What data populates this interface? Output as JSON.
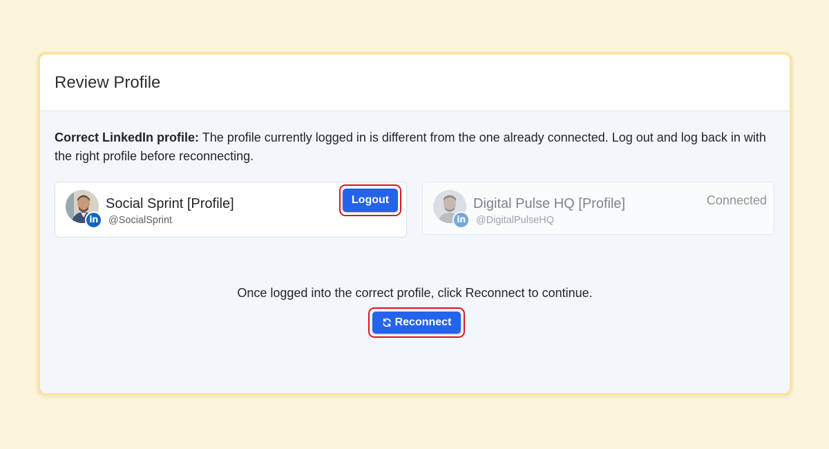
{
  "modal": {
    "title": "Review Profile"
  },
  "message": {
    "bold": "Correct LinkedIn profile:",
    "text": " The profile currently logged in is different from the one already connected. Log out and log back in with the right profile before reconnecting."
  },
  "profiles": {
    "current": {
      "name": "Social Sprint [Profile]",
      "handle": "@SocialSprint",
      "action_label": "Logout",
      "network_badge": "in"
    },
    "connected": {
      "name": "Digital Pulse HQ [Profile]",
      "handle": "@DigitalPulseHQ",
      "status": "Connected",
      "network_badge": "in"
    }
  },
  "footer": {
    "prompt": "Once logged into the correct profile, click Reconnect to continue.",
    "reconnect_label": "Reconnect"
  },
  "icons": {
    "linkedin": "linkedin-icon",
    "refresh": "refresh-icon"
  },
  "colors": {
    "primary": "#2463eb",
    "highlight": "#e0111f",
    "linkedin": "#0a66c2",
    "page_bg": "#fdf4dc"
  }
}
